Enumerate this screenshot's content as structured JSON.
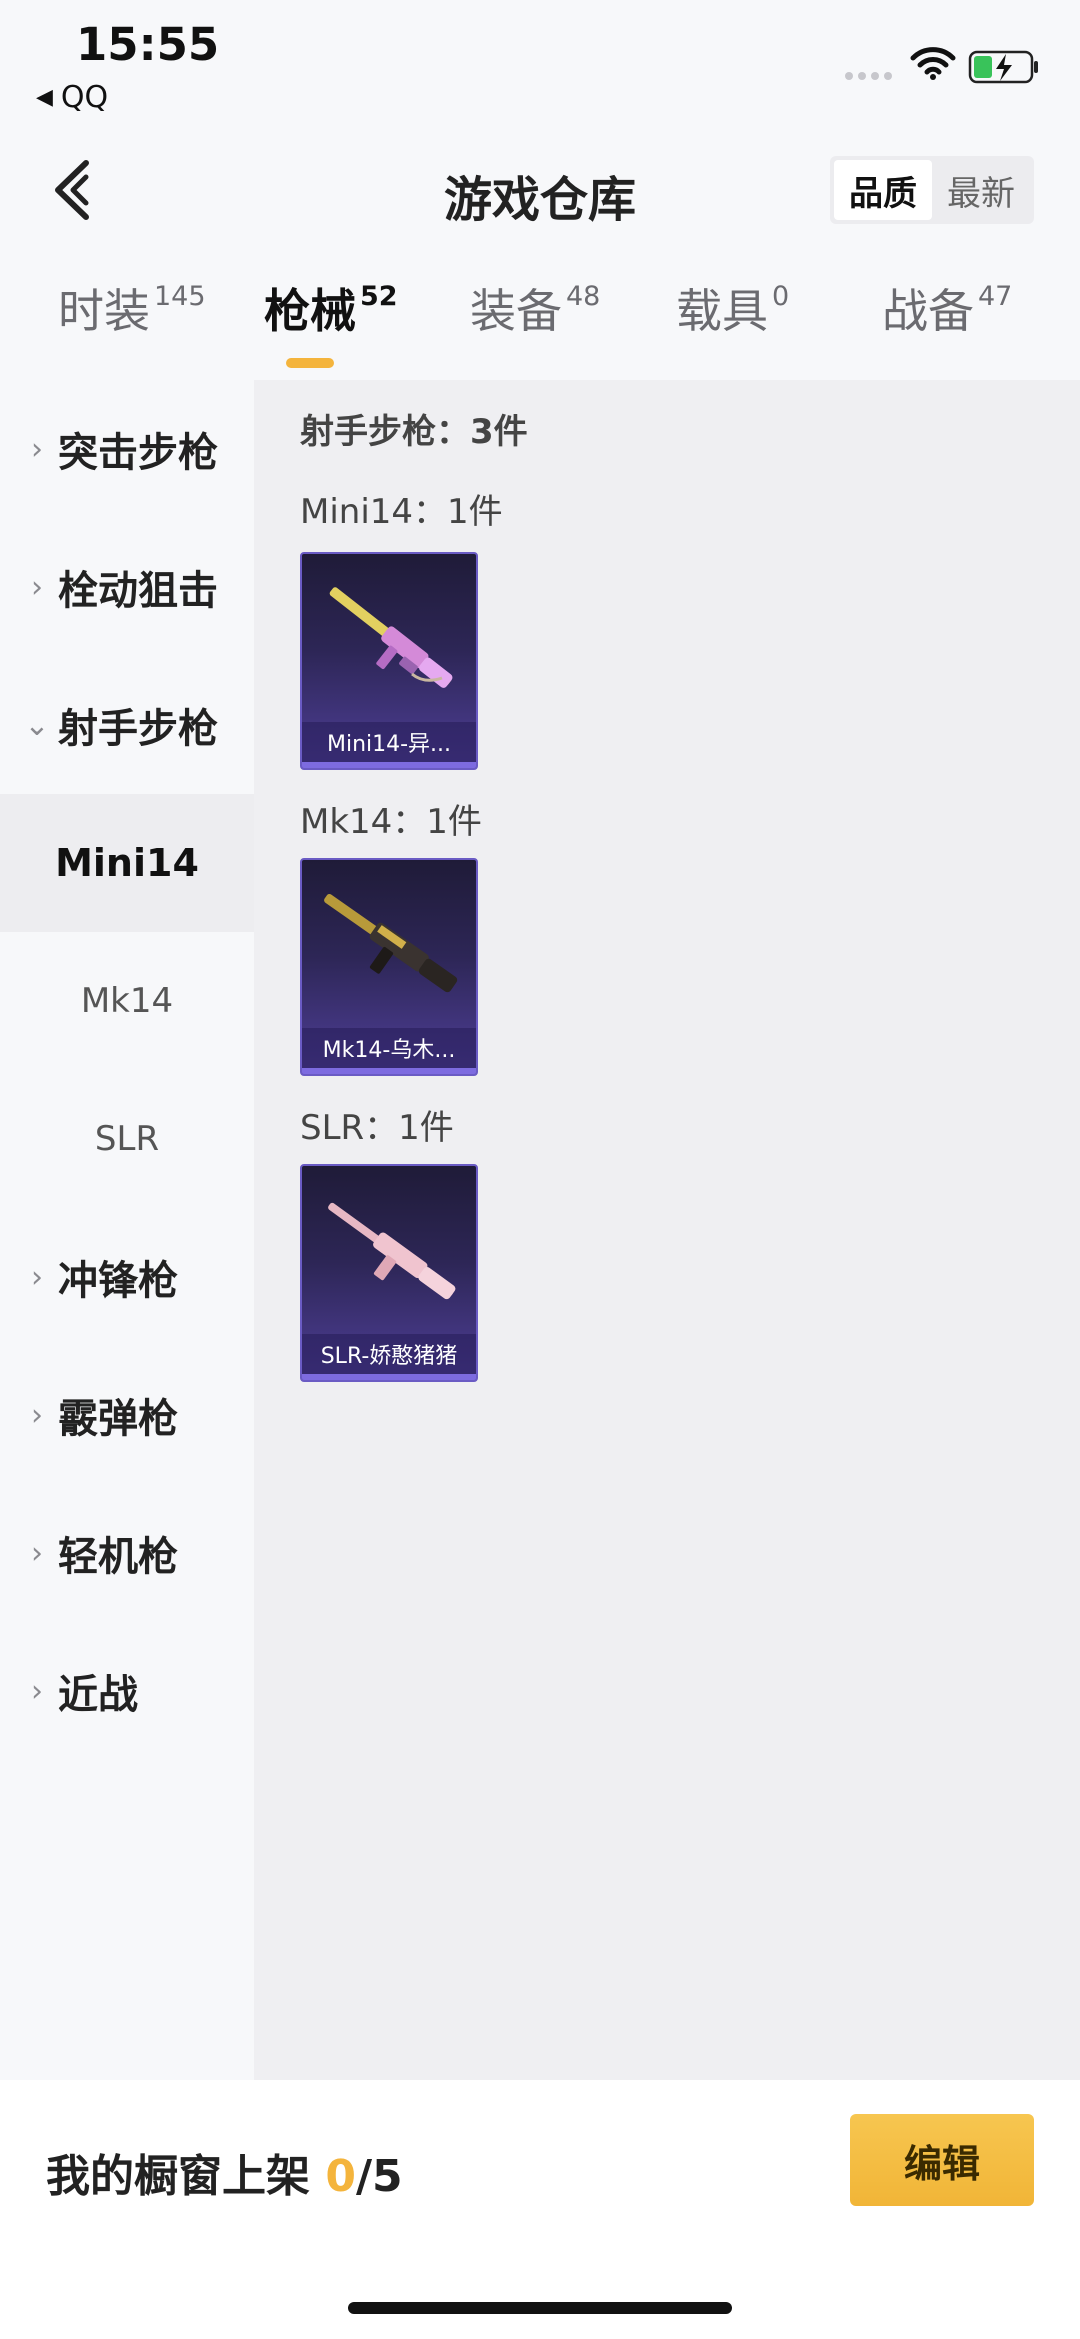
{
  "status_bar": {
    "time": "15:55",
    "back_app": "QQ"
  },
  "header": {
    "title": "游戏仓库",
    "sort_options": [
      "品质",
      "最新"
    ]
  },
  "tabs": [
    {
      "label": "时装",
      "count": "145"
    },
    {
      "label": "枪械",
      "count": "52"
    },
    {
      "label": "装备",
      "count": "48"
    },
    {
      "label": "载具",
      "count": "0"
    },
    {
      "label": "战备",
      "count": "47"
    }
  ],
  "sidebar": {
    "items": [
      {
        "label": "突击步枪"
      },
      {
        "label": "栓动狙击"
      },
      {
        "label": "射手步枪"
      }
    ],
    "sub_items": [
      {
        "label": "Mini14"
      },
      {
        "label": "Mk14"
      },
      {
        "label": "SLR"
      }
    ],
    "more_items": [
      {
        "label": "冲锋枪"
      },
      {
        "label": "霰弹枪"
      },
      {
        "label": "轻机枪"
      },
      {
        "label": "近战"
      }
    ]
  },
  "main": {
    "section_title": "射手步枪：3件",
    "groups": [
      {
        "title": "Mini14：1件",
        "card_name": "Mini14-异..."
      },
      {
        "title": "Mk14：1件",
        "card_name": "Mk14-乌木..."
      },
      {
        "title": "SLR：1件",
        "card_name": "SLR-娇憨猪猪"
      }
    ]
  },
  "bottom_bar": {
    "showcase_label": "我的橱窗上架",
    "showcase_count": "0",
    "showcase_total": "/5",
    "edit_label": "编辑"
  },
  "colors": {
    "accent": "#f4b43c",
    "card_border": "#6a5bc4"
  },
  "icons": [
    "back-arrow-icon",
    "wifi-icon",
    "battery-charging-icon",
    "chevron-right-icon",
    "chevron-down-icon"
  ]
}
